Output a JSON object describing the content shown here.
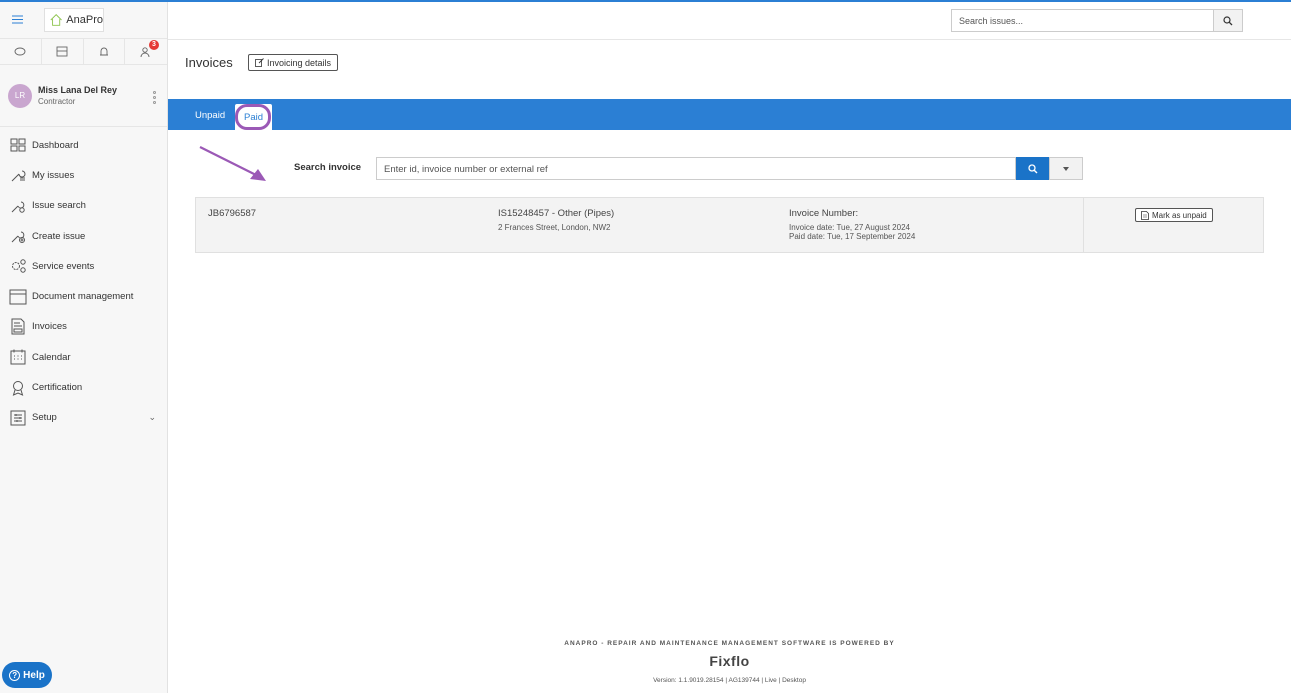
{
  "app": {
    "logo_text": "AnaPro",
    "accent": "#2b7fd4",
    "badge_color": "#e53935"
  },
  "sidebar": {
    "icons": [
      "chat-icon",
      "inbox-icon",
      "bell-icon",
      "users-icon"
    ],
    "badge_count": "3",
    "user": {
      "initials": "LR",
      "name": "Miss Lana Del Rey",
      "role": "Contractor"
    },
    "items": [
      {
        "label": "Dashboard",
        "icon": "dashboard-icon"
      },
      {
        "label": "My issues",
        "icon": "wrench-icon"
      },
      {
        "label": "Issue search",
        "icon": "search-wrench-icon"
      },
      {
        "label": "Create issue",
        "icon": "create-issue-icon"
      },
      {
        "label": "Service events",
        "icon": "gears-icon"
      },
      {
        "label": "Document management",
        "icon": "document-icon"
      },
      {
        "label": "Invoices",
        "icon": "invoice-icon"
      },
      {
        "label": "Calendar",
        "icon": "calendar-icon"
      },
      {
        "label": "Certification",
        "icon": "certificate-icon"
      },
      {
        "label": "Setup",
        "icon": "setup-icon"
      }
    ],
    "help_label": "Help"
  },
  "header": {
    "search_placeholder": "Search issues..."
  },
  "page": {
    "title": "Invoices",
    "invoicing_details_label": "Invoicing details"
  },
  "tabs": [
    {
      "label": "Unpaid",
      "active": false
    },
    {
      "label": "Paid",
      "active": true
    }
  ],
  "search": {
    "label": "Search invoice",
    "placeholder": "Enter id, invoice number or external ref"
  },
  "invoice": {
    "job_ref": "JB6796587",
    "issue": "IS15248457 - Other (Pipes)",
    "address": "2 Frances Street, London, NW2",
    "invoice_number_label": "Invoice Number:",
    "invoice_date": "Invoice date: Tue, 27 August 2024",
    "paid_date": "Paid date: Tue, 17 September 2024",
    "action_label": "Mark as unpaid"
  },
  "footer": {
    "powered_by": "ANAPRO - REPAIR AND MAINTENANCE MANAGEMENT SOFTWARE IS POWERED BY",
    "brand": "Fixflo",
    "version": "Version: 1.1.9019.28154   |   AG139744   |   Live   |   Desktop"
  }
}
